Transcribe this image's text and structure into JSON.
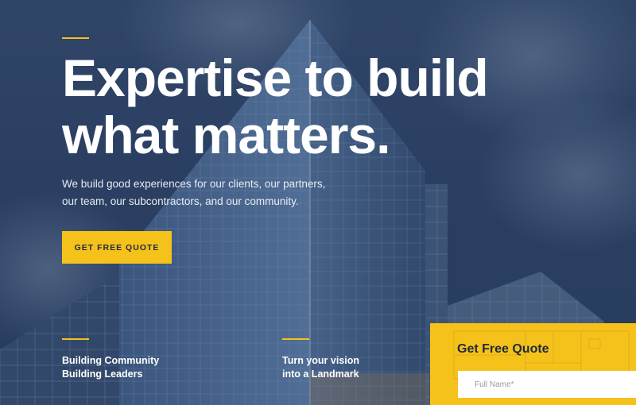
{
  "hero": {
    "headline_line1": "Expertise to build",
    "headline_line2": "what matters.",
    "subtitle_line1": "We build good experiences for our clients, our partners,",
    "subtitle_line2": "our team, our subcontractors, and our community.",
    "cta_label": "GET FREE QUOTE"
  },
  "features": [
    {
      "line1": "Building Community",
      "line2": "Building Leaders"
    },
    {
      "line1": "Turn your vision",
      "line2": "into a Landmark"
    }
  ],
  "quote_form": {
    "title": "Get Free Quote",
    "full_name_placeholder": "Full Name*",
    "full_name_value": ""
  },
  "colors": {
    "accent": "#f5c21b",
    "overlay": "#2d4263",
    "text_light": "#ffffff",
    "text_dark": "#1f2a3a"
  }
}
